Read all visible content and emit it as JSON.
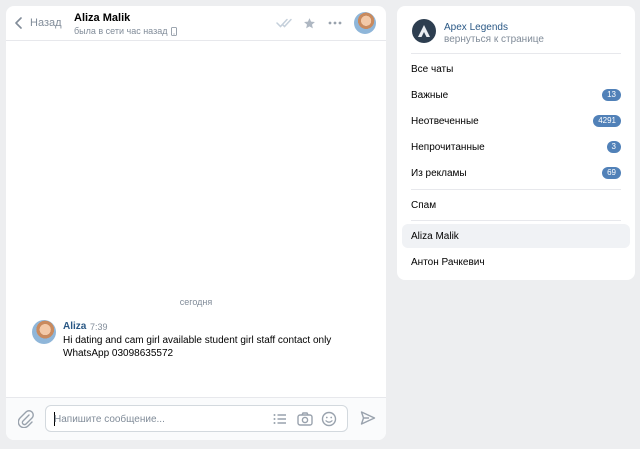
{
  "chat": {
    "back_label": "Назад",
    "peer_name": "Aliza Malik",
    "peer_status": "была в сети час назад",
    "date_separator": "сегодня",
    "messages": [
      {
        "author": "Aliza",
        "time": "7:39",
        "text": "Hi dating and cam girl available student girl staff contact only WhatsApp 03098635572"
      }
    ],
    "composer": {
      "placeholder": "Напишите сообщение..."
    }
  },
  "sidebar": {
    "group_name": "Apex Legends",
    "group_back": "вернуться к странице",
    "folders": [
      {
        "label": "Все чаты",
        "count": ""
      },
      {
        "label": "Важные",
        "count": "13"
      },
      {
        "label": "Неотвеченные",
        "count": "4291"
      },
      {
        "label": "Непрочитанные",
        "count": "3"
      },
      {
        "label": "Из рекламы",
        "count": "69"
      },
      {
        "label": "Спам",
        "count": ""
      },
      {
        "label": "Aliza Malik",
        "count": ""
      },
      {
        "label": "Антон Рачкевич",
        "count": ""
      }
    ],
    "active_folder": "Aliza Malik"
  },
  "colors": {
    "background": "#edeef0",
    "link": "#2a5885",
    "badge": "#5181b8",
    "secondary_text": "#818c99"
  },
  "icons": [
    "chevron-left-icon",
    "phone-icon",
    "double-check-icon",
    "star-icon",
    "more-icon",
    "paperclip-icon",
    "list-icon",
    "camera-icon",
    "smile-icon",
    "send-icon"
  ]
}
